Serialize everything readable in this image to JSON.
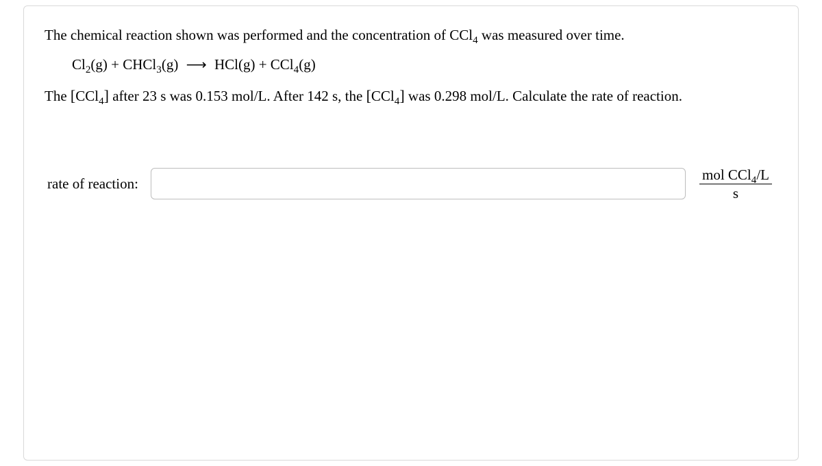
{
  "problem": {
    "intro_a": "The chemical reaction shown was performed and the concentration of CCl",
    "intro_b": " was measured over time.",
    "species_sub": "4",
    "equation": {
      "r1_base": "Cl",
      "r1_sub": "2",
      "r1_phase": "(g)",
      "plus1": " + ",
      "r2_base": "CHCl",
      "r2_sub": "3",
      "r2_phase": "(g)",
      "arrow": "⟶",
      "p1_base": "HCl",
      "p1_phase": "(g)",
      "plus2": " + ",
      "p2_base": "CCl",
      "p2_sub": "4",
      "p2_phase": "(g)"
    },
    "data_line": {
      "a": "The ",
      "lb1": "[",
      "sp1_base": "CCl",
      "sp1_sub": "4",
      "rb1": "]",
      "b": " after 23 s was 0.153 mol/L. After 142 s, the ",
      "lb2": "[",
      "sp2_base": "CCl",
      "sp2_sub": "4",
      "rb2": "]",
      "c": " was 0.298 mol/L. Calculate the rate of reaction."
    }
  },
  "answer": {
    "label": "rate of reaction:",
    "value": "",
    "unit_top_a": "mol CCl",
    "unit_top_sub": "4",
    "unit_top_b": "/L",
    "unit_bot": "s"
  }
}
